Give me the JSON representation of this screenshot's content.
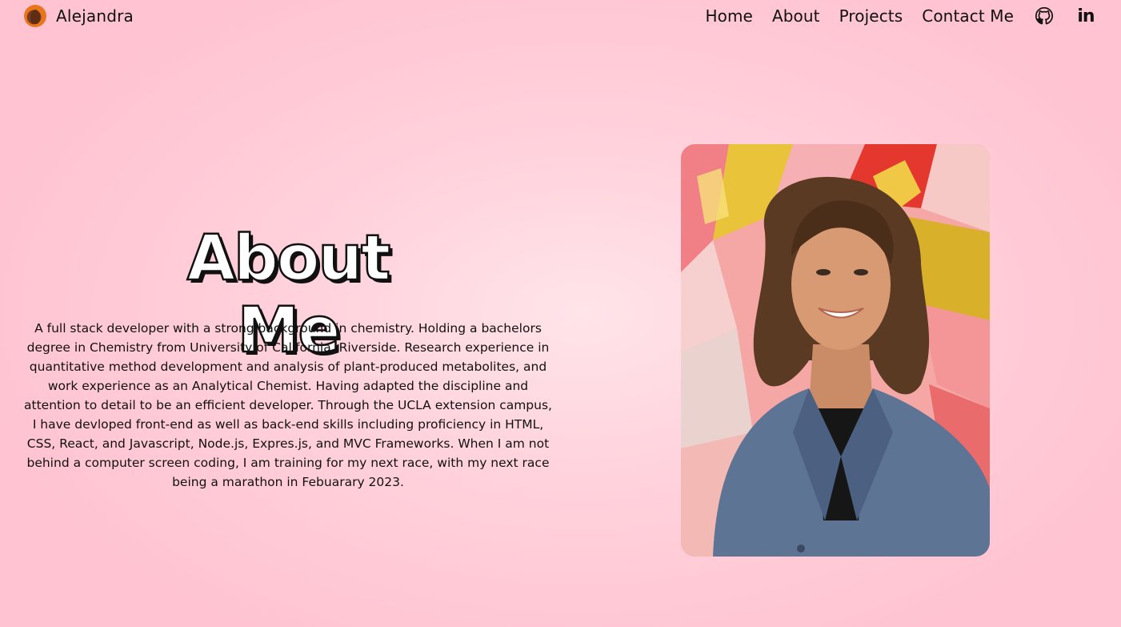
{
  "nav": {
    "brand": "Alejandra",
    "links": [
      "Home",
      "About",
      "Projects",
      "Contact Me"
    ],
    "icons": [
      "github-icon",
      "linkedin-icon"
    ],
    "linkedin_glyph": "in"
  },
  "about": {
    "title": "About Me",
    "text": "A full stack developer with a strong background in chemistry. Holding a bachelors degree in Chemistry from University of California, Riverside. Research experience in quantitative method development and analysis of plant-produced metabolites, and work experience as an Analytical Chemist. Having adapted the discipline and attention to detail to be an efficient developer. Through the UCLA extension campus, I have devloped front-end as well as back-end skills including proficiency in HTML, CSS, React, and Javascript, Node.js, Expres.js, and MVC Frameworks. When I am not behind a computer screen coding, I am training for my next race, with my next race being a marathon in Febuarary 2023."
  },
  "colors": {
    "background": "#ffd2dc",
    "text": "#111111",
    "accent_logo": "#e7761c"
  }
}
